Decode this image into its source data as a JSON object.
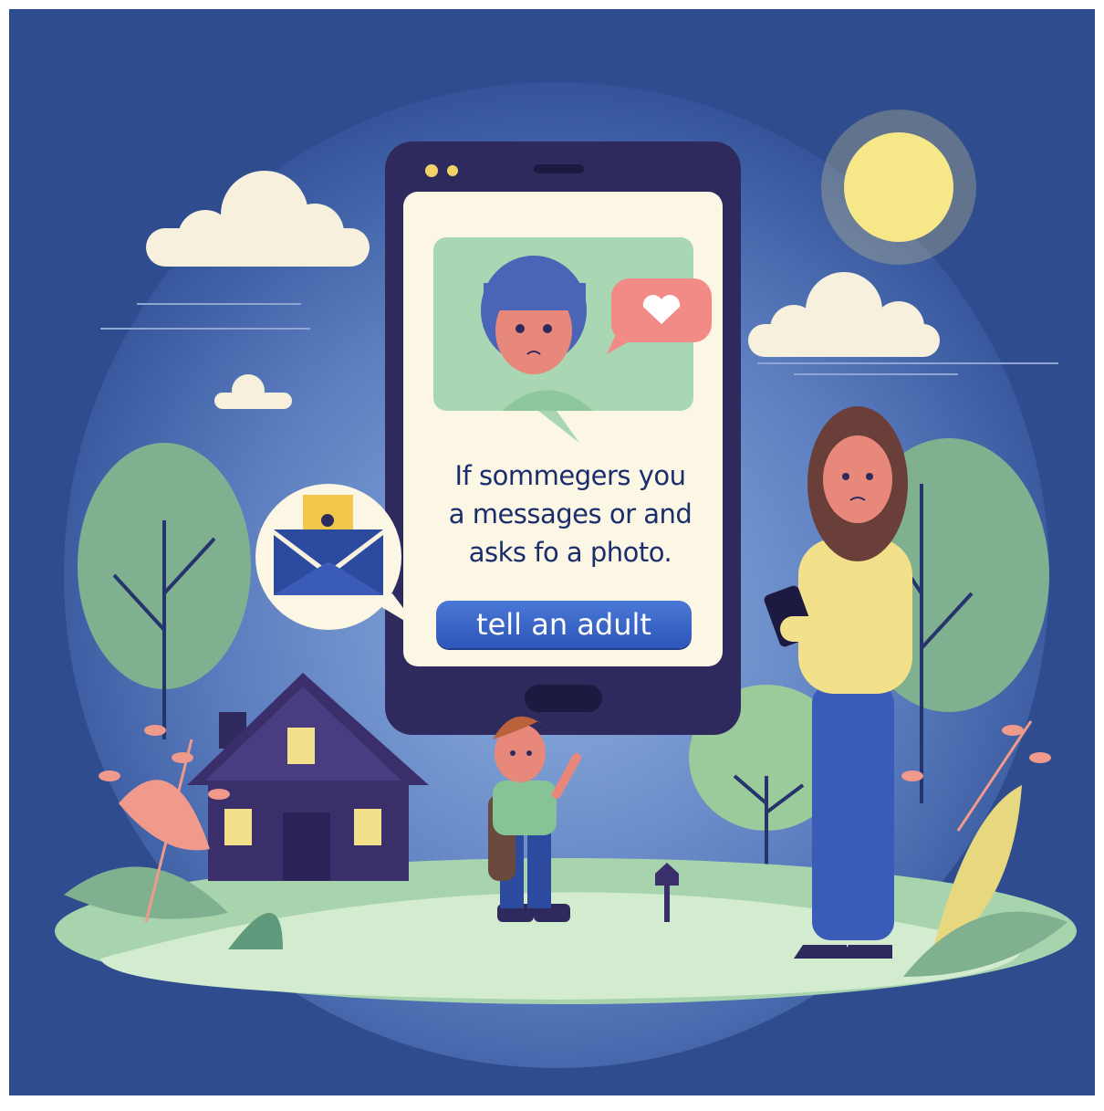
{
  "phone": {
    "message_lines": [
      "If sommegers you",
      "a messages or and",
      "asks fo a photo."
    ],
    "button_label": "tell an adult"
  },
  "colors": {
    "sky": "#2f4c8f",
    "glow": "#6e8fc8",
    "phone_body": "#2e2a5e",
    "screen": "#fbf7e4",
    "button": "#3a66c8",
    "grass": "#c8e6c8",
    "sun": "#f6e889",
    "heart_bubble": "#f28b86"
  },
  "icons": [
    "heart-icon",
    "envelope-icon",
    "sun-icon",
    "house-icon",
    "mailbox-icon"
  ]
}
